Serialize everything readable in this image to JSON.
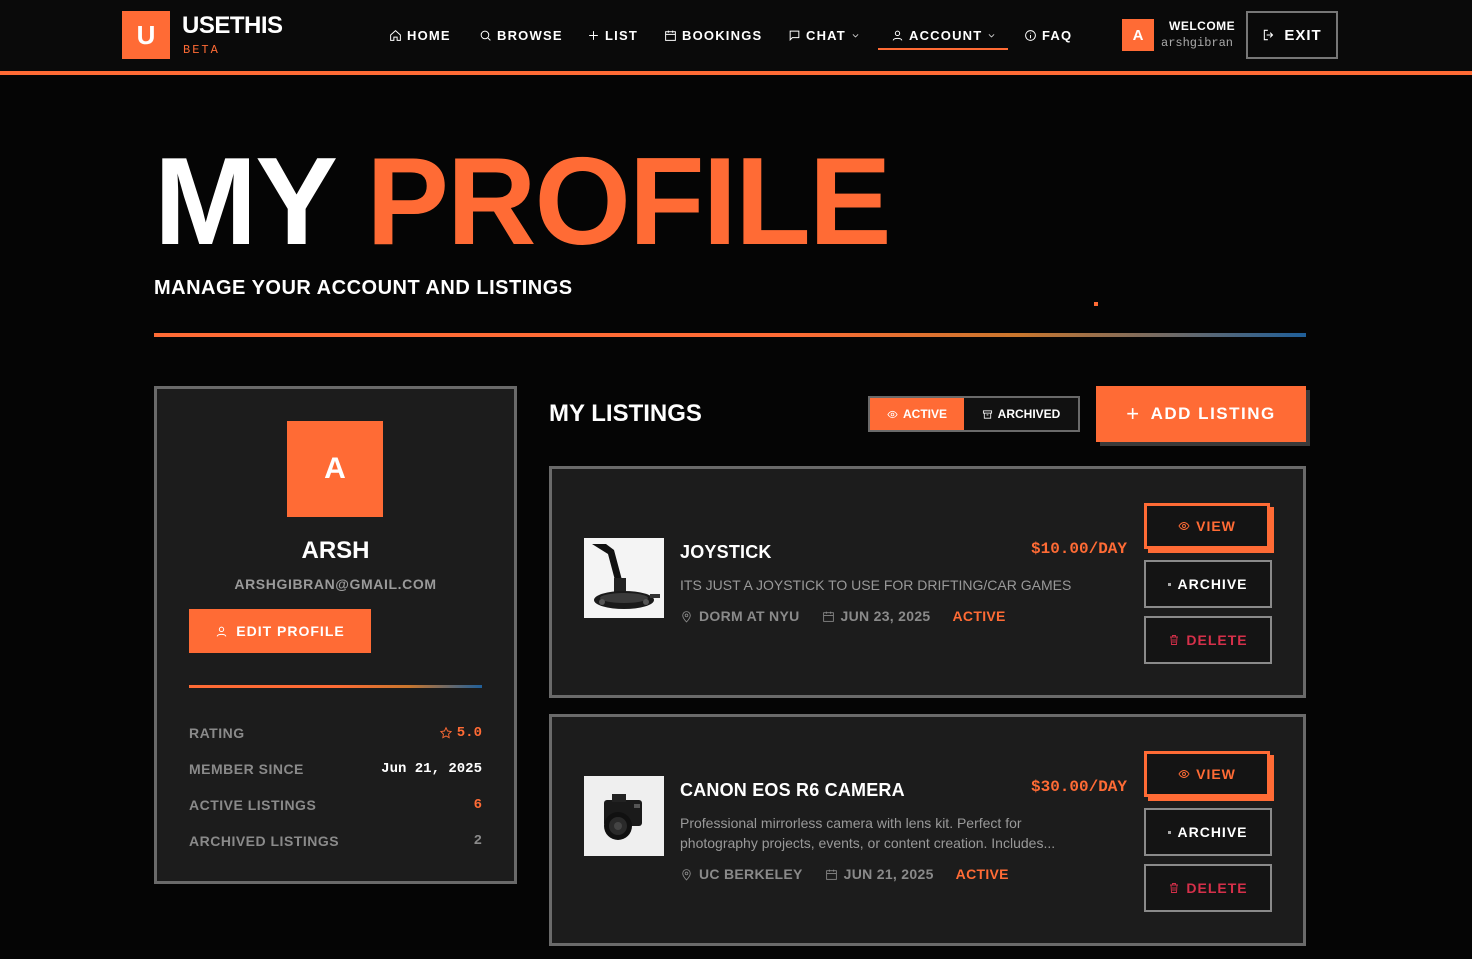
{
  "nav": {
    "logo_letter": "U",
    "brand": "USETHIS",
    "beta": "BETA",
    "items": [
      {
        "label": "HOME",
        "icon": "home-icon"
      },
      {
        "label": "BROWSE",
        "icon": "search-icon"
      },
      {
        "label": "LIST",
        "icon": "plus-icon"
      },
      {
        "label": "BOOKINGS",
        "icon": "calendar-icon"
      },
      {
        "label": "CHAT",
        "icon": "chat-icon"
      },
      {
        "label": "ACCOUNT",
        "icon": "user-icon"
      },
      {
        "label": "FAQ",
        "icon": "info-icon"
      }
    ],
    "user_initial": "A",
    "welcome": "WELCOME",
    "username": "arshgibran",
    "exit_label": "EXIT"
  },
  "hero": {
    "title_part1": "MY",
    "title_part2": "PROFILE",
    "subtitle": "MANAGE YOUR ACCOUNT AND LISTINGS"
  },
  "profile": {
    "initial": "A",
    "name": "ARSH",
    "email": "ARSHGIBRAN@GMAIL.COM",
    "edit_label": "EDIT PROFILE",
    "stats": [
      {
        "label": "RATING",
        "value": "5.0"
      },
      {
        "label": "MEMBER SINCE",
        "value": "Jun 21, 2025"
      },
      {
        "label": "ACTIVE LISTINGS",
        "value": "6"
      },
      {
        "label": "ARCHIVED LISTINGS",
        "value": "2"
      }
    ]
  },
  "listings": {
    "title": "MY LISTINGS",
    "toggle_active": "ACTIVE",
    "toggle_archived": "ARCHIVED",
    "add_label": "ADD LISTING",
    "items": [
      {
        "title": "JOYSTICK",
        "price": "$10.00/DAY",
        "description": "ITS JUST A JOYSTICK TO USE FOR DRIFTING/CAR GAMES",
        "location": "DORM AT NYU",
        "date": "JUN 23, 2025",
        "status": "ACTIVE"
      },
      {
        "title": "CANON EOS R6 CAMERA",
        "price": "$30.00/DAY",
        "description": "Professional mirrorless camera with lens kit. Perfect for photography projects, events, or content creation. Includes...",
        "location": "UC BERKELEY",
        "date": "JUN 21, 2025",
        "status": "ACTIVE"
      }
    ],
    "view_label": "VIEW",
    "archive_label": "ARCHIVE",
    "delete_label": "DELETE"
  },
  "colors": {
    "accent": "#ff6b35",
    "background": "#050505",
    "card": "#1c1c1c",
    "danger": "#d6304a"
  }
}
